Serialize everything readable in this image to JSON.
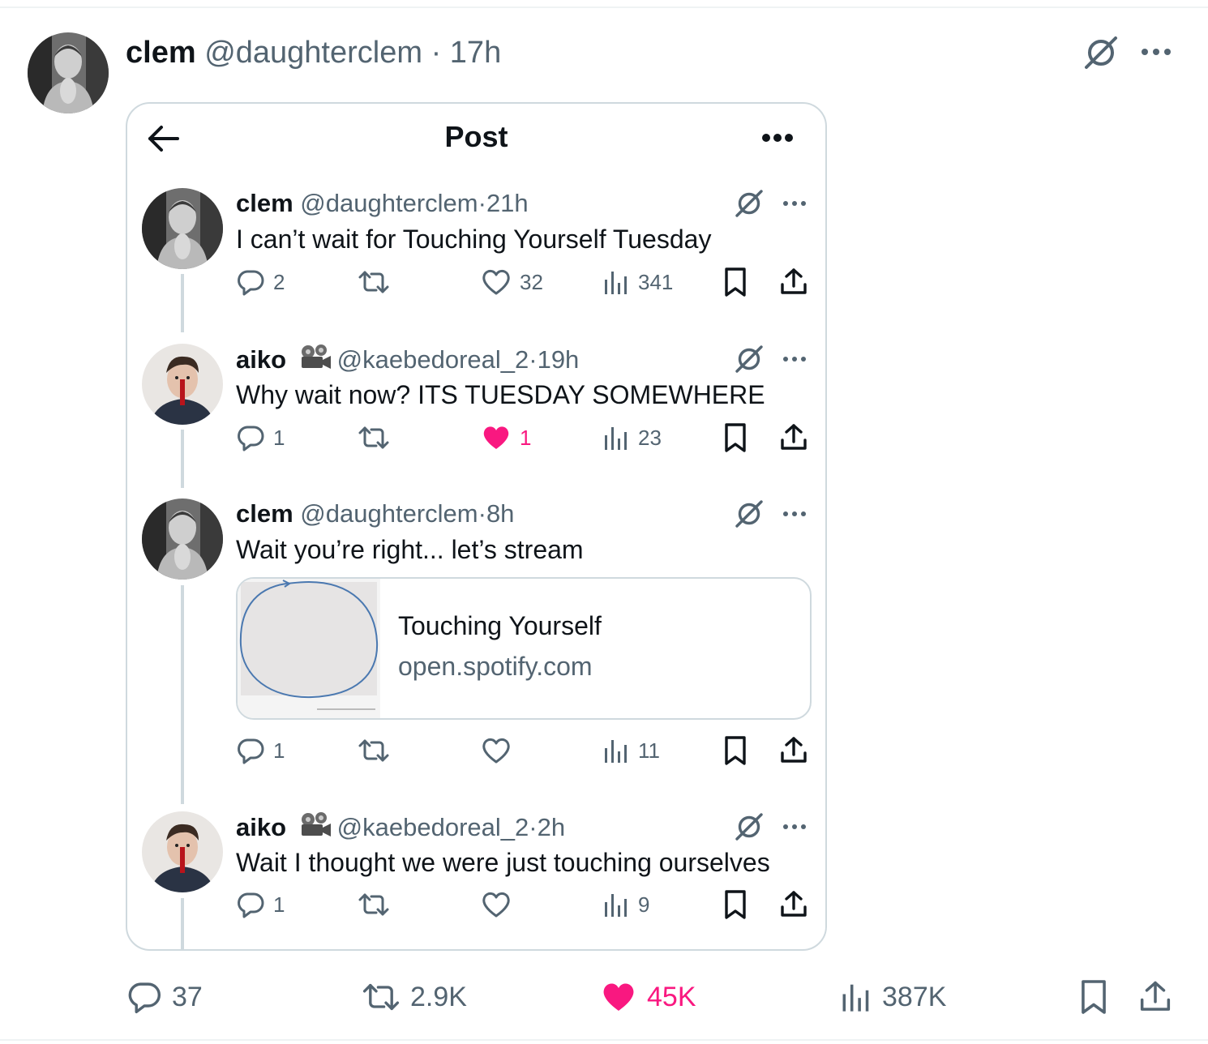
{
  "post": {
    "author_name": "clem",
    "author_handle": "@daughterclem",
    "separator": "·",
    "time": "17h",
    "stats": {
      "replies": "37",
      "reposts": "2.9K",
      "likes": "45K",
      "views": "387K"
    },
    "liked": true
  },
  "card": {
    "title": "Post",
    "tweets": [
      {
        "name": "clem",
        "handle": "@daughterclem",
        "time": "21h",
        "text": "I can’t wait for Touching Yourself Tuesday",
        "replies": "2",
        "reposts": "",
        "likes": "32",
        "views": "341",
        "liked": false
      },
      {
        "name": "aiko",
        "handle": "@kaebedoreal_2",
        "time": "19h",
        "text": "Why wait now? ITS TUESDAY SOMEWHERE",
        "replies": "1",
        "reposts": "",
        "likes": "1",
        "views": "23",
        "liked": true
      },
      {
        "name": "clem",
        "handle": "@daughterclem",
        "time": "8h",
        "text": "Wait you’re right... let’s stream",
        "replies": "1",
        "reposts": "",
        "likes": "",
        "views": "11",
        "liked": false,
        "link": {
          "title": "Touching Yourself",
          "domain": "open.spotify.com"
        }
      },
      {
        "name": "aiko",
        "handle": "@kaebedoreal_2",
        "time": "2h",
        "text": "Wait I thought we were just touching ourselves",
        "replies": "1",
        "reposts": "",
        "likes": "",
        "views": "9",
        "liked": false
      }
    ]
  },
  "colors": {
    "text": "#0f1419",
    "muted": "#536471",
    "like": "#f91880",
    "border": "#cfd9de"
  },
  "icons": [
    "avatar",
    "grok-icon",
    "more-icon",
    "back-arrow-icon",
    "reply-icon",
    "repost-icon",
    "like-icon",
    "views-icon",
    "bookmark-icon",
    "share-icon",
    "camera-badge-icon"
  ]
}
